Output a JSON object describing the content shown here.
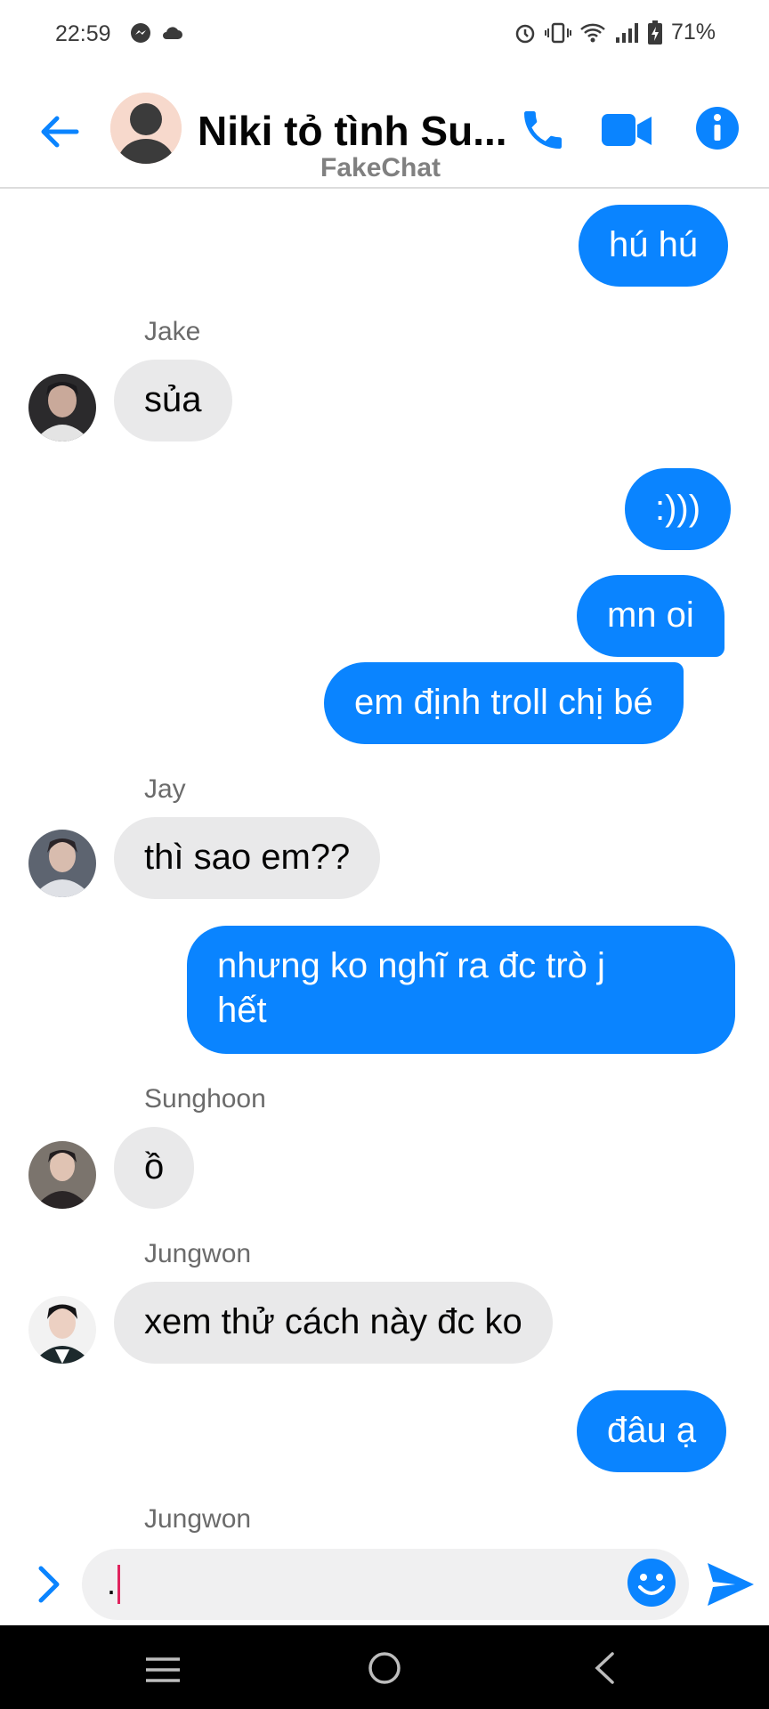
{
  "status": {
    "time": "22:59",
    "battery": "71%"
  },
  "header": {
    "title": "Niki tỏ tình Su...",
    "watermark": "FakeChat"
  },
  "messages": [
    {
      "side": "out",
      "text": "hú hú"
    },
    {
      "side": "in",
      "sender": "Jake",
      "text": "sủa"
    },
    {
      "side": "out",
      "text": ":)))"
    },
    {
      "side": "out",
      "text": "mn oi"
    },
    {
      "side": "out",
      "text": "em định troll chị bé"
    },
    {
      "side": "in",
      "sender": "Jay",
      "text": "thì sao em??"
    },
    {
      "side": "out",
      "line1": "nhưng ko nghĩ ra đc trò j",
      "line2": "hết"
    },
    {
      "side": "in",
      "sender": "Sunghoon",
      "text": "ồ"
    },
    {
      "side": "in",
      "sender": "Jungwon",
      "text": "xem thử cách này đc ko"
    },
    {
      "side": "out",
      "text": "đâu ạ"
    },
    {
      "side": "in",
      "sender": "Jungwon"
    }
  ],
  "composer": {
    "input_value": "."
  },
  "colors": {
    "accent": "#0a84ff",
    "incoming_bubble": "#e9e9ea",
    "caret": "#e0245e"
  },
  "icons": [
    "back-arrow-icon",
    "phone-icon",
    "video-camera-icon",
    "info-icon",
    "chevron-right-icon",
    "emoji-icon",
    "send-icon",
    "alarm-icon",
    "vibrate-icon",
    "wifi-icon",
    "signal-icon",
    "battery-icon",
    "messenger-icon",
    "cloud-icon",
    "nav-menu-icon",
    "nav-home-icon",
    "nav-back-icon"
  ]
}
